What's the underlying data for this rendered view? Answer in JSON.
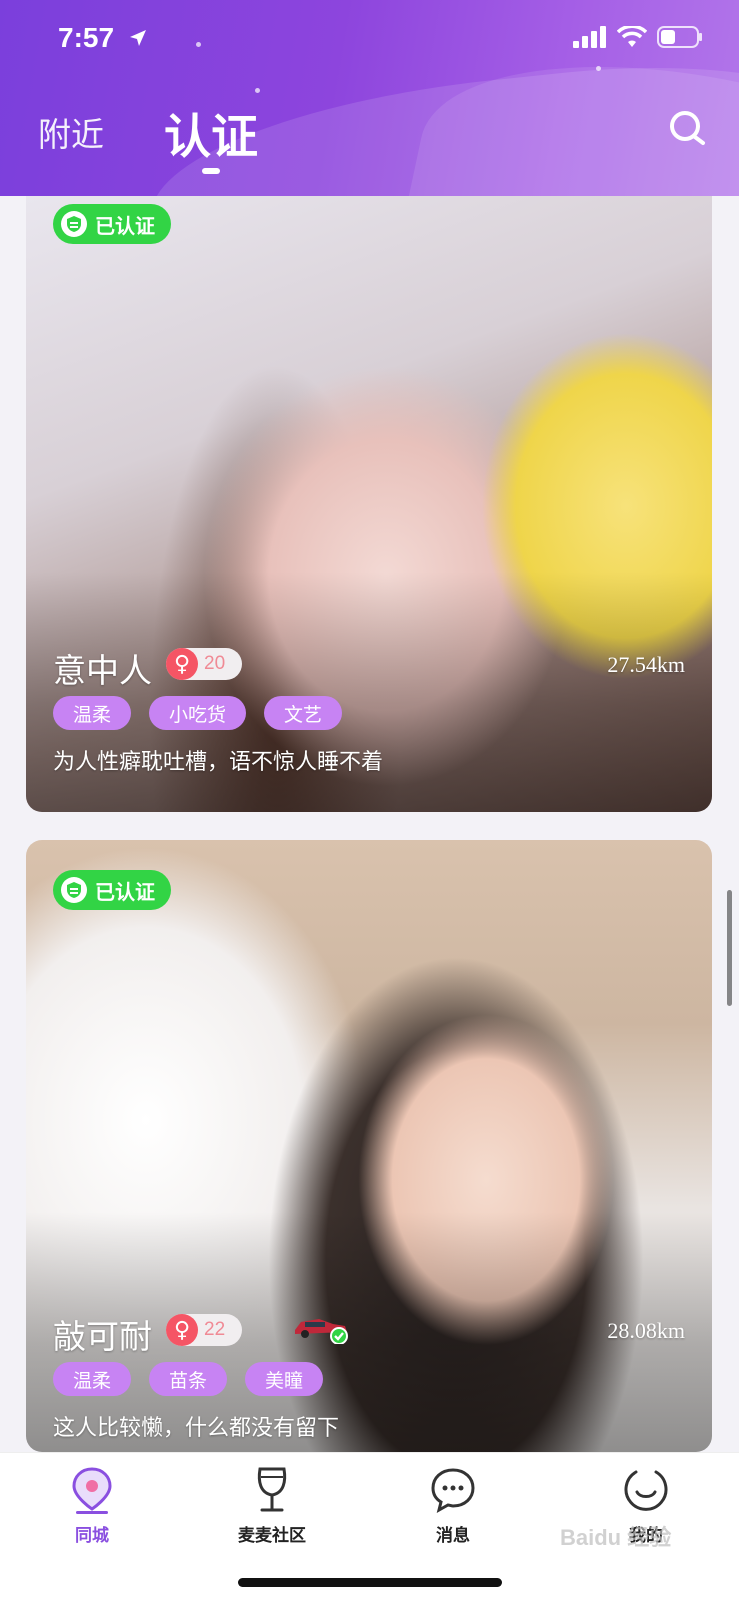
{
  "status_bar": {
    "time": "7:57"
  },
  "header": {
    "tabs": [
      {
        "label": "附近",
        "active": false
      },
      {
        "label": "认证",
        "active": true
      }
    ]
  },
  "cards": [
    {
      "badge": "已认证",
      "name": "意中人",
      "gender": "♀",
      "age": "20",
      "distance": "27.54km",
      "tags": [
        "温柔",
        "小吃货",
        "文艺"
      ],
      "bio": "为人性癖耽吐槽，语不惊人睡不着"
    },
    {
      "badge": "已认证",
      "name": "敲可耐",
      "gender": "♀",
      "age": "22",
      "distance": "28.08km",
      "tags": [
        "温柔",
        "苗条",
        "美瞳"
      ],
      "bio": "这人比较懒，什么都没有留下"
    }
  ],
  "bottom_nav": [
    {
      "label": "同城",
      "icon": "location-pin-icon",
      "active": true
    },
    {
      "label": "麦麦社区",
      "icon": "wine-glass-icon",
      "active": false
    },
    {
      "label": "消息",
      "icon": "chat-bubble-icon",
      "active": false
    },
    {
      "label": "我的",
      "icon": "smiley-profile-icon",
      "active": false
    }
  ],
  "watermark": "Baidu 经验",
  "colors": {
    "accent": "#8a4fe0",
    "verified_green": "#32d445",
    "tag_purple": "#c783f3",
    "female_red": "#f55565"
  }
}
